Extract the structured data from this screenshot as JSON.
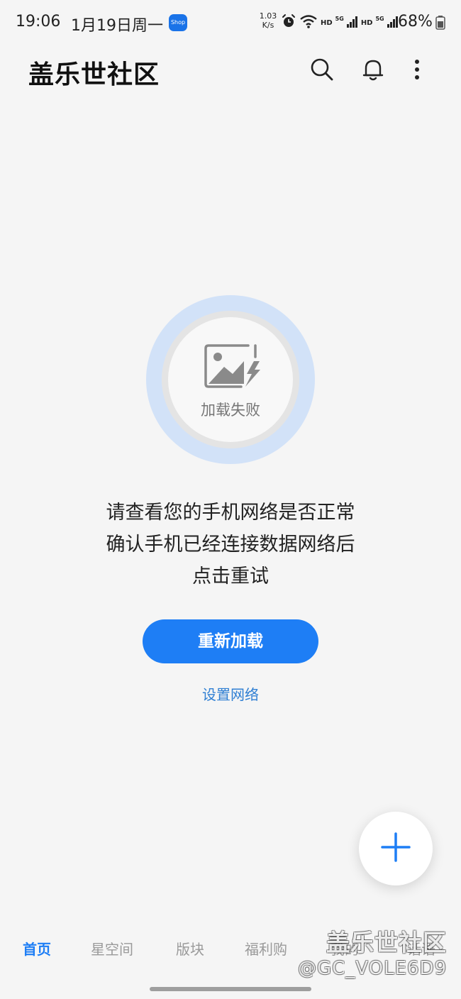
{
  "status_bar": {
    "time": "19:06",
    "date": "1月19日周一",
    "shop_badge": "Shop",
    "net_speed_value": "1.03",
    "net_speed_unit": "K/s",
    "hd_label_1": "HD",
    "hd_label_2": "HD",
    "signal_1_type": "5G",
    "signal_2_type": "5G",
    "battery": "68%",
    "icons": [
      "alarm-icon",
      "wifi-icon",
      "signal-icon",
      "battery-icon"
    ]
  },
  "header": {
    "title": "盖乐世社区",
    "actions": [
      "search-icon",
      "bell-icon",
      "more-vertical-icon"
    ]
  },
  "error_state": {
    "image_caption": "加载失败",
    "message_lines": [
      "请查看您的手机网络是否正常",
      "确认手机已经连接数据网络后",
      "点击重试"
    ],
    "reload_button": "重新加载",
    "settings_link": "设置网络"
  },
  "fab": {
    "icon": "plus-icon"
  },
  "bottom_nav": {
    "items": [
      {
        "label": "首页",
        "active": true
      },
      {
        "label": "星空间",
        "active": false
      },
      {
        "label": "版块",
        "active": false
      },
      {
        "label": "福利购",
        "active": false
      },
      {
        "label": "我的",
        "active": false
      },
      {
        "label": "话语",
        "active": false
      }
    ]
  },
  "watermark": {
    "logo_text": "盖乐世社区",
    "user": "@GC_VOLE6D9"
  },
  "colors": {
    "background": "#f5f5f5",
    "accent": "#1e7ef5",
    "link": "#2f7fd3",
    "ring": "#d2e2f8",
    "inactive_nav": "#9a9a9a"
  }
}
